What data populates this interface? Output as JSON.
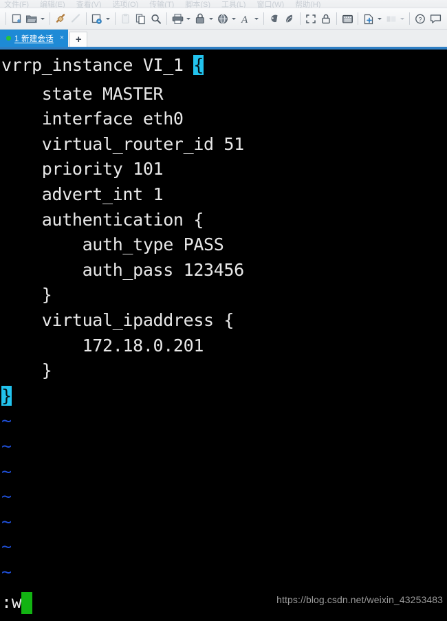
{
  "menu": {
    "items": [
      "文件(F)",
      "编辑(E)",
      "查看(V)",
      "选项(O)",
      "传输(T)",
      "脚本(S)",
      "工具(L)",
      "窗口(W)",
      "帮助(H)"
    ]
  },
  "toolbar": {
    "buttons": [
      {
        "name": "new-session-icon",
        "label": "新建会话"
      },
      {
        "name": "open-folder-icon",
        "label": "打开"
      },
      {
        "name": "connect-icon",
        "label": "连接"
      },
      {
        "name": "disconnect-icon",
        "label": "断开"
      },
      {
        "name": "session-options-icon",
        "label": "会话选项"
      },
      {
        "name": "paste-icon",
        "label": "粘贴"
      },
      {
        "name": "copy-icon",
        "label": "复制"
      },
      {
        "name": "find-icon",
        "label": "查找"
      },
      {
        "name": "print-icon",
        "label": "打印"
      },
      {
        "name": "log-session-icon",
        "label": "记录会话"
      },
      {
        "name": "globe-icon",
        "label": "传输"
      },
      {
        "name": "font-icon",
        "label": "字体"
      },
      {
        "name": "transfer-zmodem-icon",
        "label": "Zmodem"
      },
      {
        "name": "transfer-xfer-icon",
        "label": "传输文件"
      },
      {
        "name": "fullscreen-icon",
        "label": "全屏"
      },
      {
        "name": "lock-icon",
        "label": "锁定"
      },
      {
        "name": "keymap-icon",
        "label": "键盘映射"
      },
      {
        "name": "add-tab-icon",
        "label": "新建标签"
      },
      {
        "name": "tile-icon",
        "label": "平铺"
      },
      {
        "name": "help-icon",
        "label": "帮助"
      },
      {
        "name": "chat-icon",
        "label": "聊天窗口"
      }
    ]
  },
  "tabs": {
    "active": {
      "label": "1 新建会话",
      "close": "×"
    },
    "add_label": "+"
  },
  "terminal": {
    "lines": [
      {
        "text": "vrrp_instance VI_1 ",
        "highlight": "{"
      },
      {
        "text": "    state MASTER"
      },
      {
        "text": "    interface eth0"
      },
      {
        "text": "    virtual_router_id 51"
      },
      {
        "text": "    priority 101"
      },
      {
        "text": "    advert_int 1"
      },
      {
        "text": "    authentication {"
      },
      {
        "text": "        auth_type PASS"
      },
      {
        "text": "        auth_pass 123456"
      },
      {
        "text": "    }"
      },
      {
        "text": "    virtual_ipaddress {"
      },
      {
        "text": "        172.18.0.201"
      },
      {
        "text": "    }"
      },
      {
        "text": "",
        "highlight": "}"
      }
    ],
    "empty_marker": "~",
    "empty_marker_count": 7,
    "command_line": ":w",
    "colors": {
      "background": "#000000",
      "foreground": "#e8e8e8",
      "brace_highlight_bg": "#22c3ee",
      "tilde": "#1f4fd8",
      "cursor": "#12b312"
    }
  },
  "watermark": {
    "text": "https://blog.csdn.net/weixin_43253483"
  }
}
